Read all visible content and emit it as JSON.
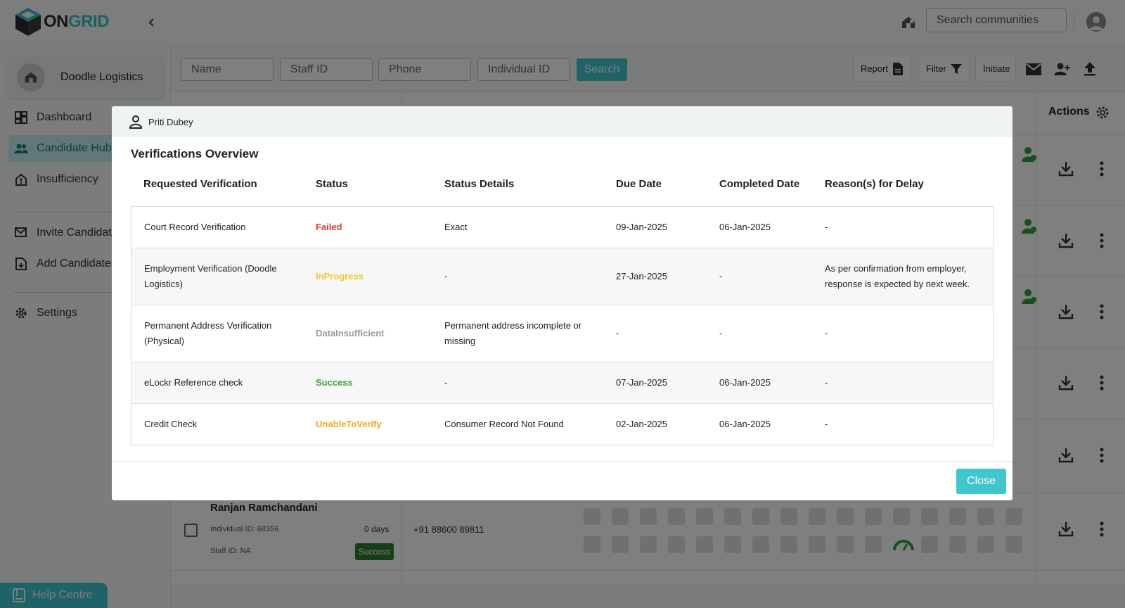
{
  "brand": {
    "logo_on": "ON",
    "logo_grid": "GRID"
  },
  "header": {
    "search_placeholder": "Search communities"
  },
  "sidebar": {
    "org_name": "Doodle Logistics",
    "items": [
      {
        "label": "Dashboard",
        "icon": "dashboard-icon"
      },
      {
        "label": "Candidate Hub",
        "icon": "people-icon",
        "active": true
      },
      {
        "label": "Insufficiency",
        "icon": "alert-house-icon"
      },
      {
        "label": "Invite Candidate",
        "icon": "mail-forward-icon"
      },
      {
        "label": "Add Candidates",
        "icon": "add-file-icon"
      },
      {
        "label": "Settings",
        "icon": "gear-icon"
      }
    ],
    "help_label": "Help Centre"
  },
  "toolbar": {
    "name_placeholder": "Name",
    "staff_placeholder": "Staff ID",
    "phone_placeholder": "Phone",
    "individual_placeholder": "Individual ID",
    "search_label": "Search",
    "report_label": "Report",
    "filter_label": "Filter",
    "initiate_label": "Initiate"
  },
  "table": {
    "actions_label": "Actions",
    "candidate": {
      "name": "Ranjan Ramchandani",
      "individual_id": "Individual ID: 68356",
      "staff_id": "Staff ID: NA",
      "days": "0 days",
      "status": "Success",
      "phone": "+91 88600 89811"
    }
  },
  "modal": {
    "user_name": "Priti Dubey",
    "title": "Verifications Overview",
    "columns": [
      "Requested Verification",
      "Status",
      "Status Details",
      "Due Date",
      "Completed Date",
      "Reason(s) for Delay"
    ],
    "rows": [
      {
        "verification": "Court Record Verification",
        "status": "Failed",
        "status_class": "st-failed",
        "details": "Exact",
        "due": "09-Jan-2025",
        "completed": "06-Jan-2025",
        "reason": "-"
      },
      {
        "verification": "Employment Verification (Doodle Logistics)",
        "status": "InProgress",
        "status_class": "st-inprogress",
        "details": "-",
        "due": "27-Jan-2025",
        "completed": "-",
        "reason": "As per confirmation from employer, response is expected by next week."
      },
      {
        "verification": "Permanent Address Verification (Physical)",
        "status": "DataInsufficient",
        "status_class": "st-datainsufficient",
        "details": "Permanent address incomplete or missing",
        "due": "-",
        "completed": "-",
        "reason": "-"
      },
      {
        "verification": "eLockr Reference check",
        "status": "Success",
        "status_class": "st-success",
        "details": "-",
        "due": "07-Jan-2025",
        "completed": "06-Jan-2025",
        "reason": "-"
      },
      {
        "verification": "Credit Check",
        "status": "UnableToVerify",
        "status_class": "st-unable",
        "details": "Consumer Record Not Found",
        "due": "02-Jan-2025",
        "completed": "06-Jan-2025",
        "reason": "-"
      }
    ],
    "close_label": "Close"
  }
}
